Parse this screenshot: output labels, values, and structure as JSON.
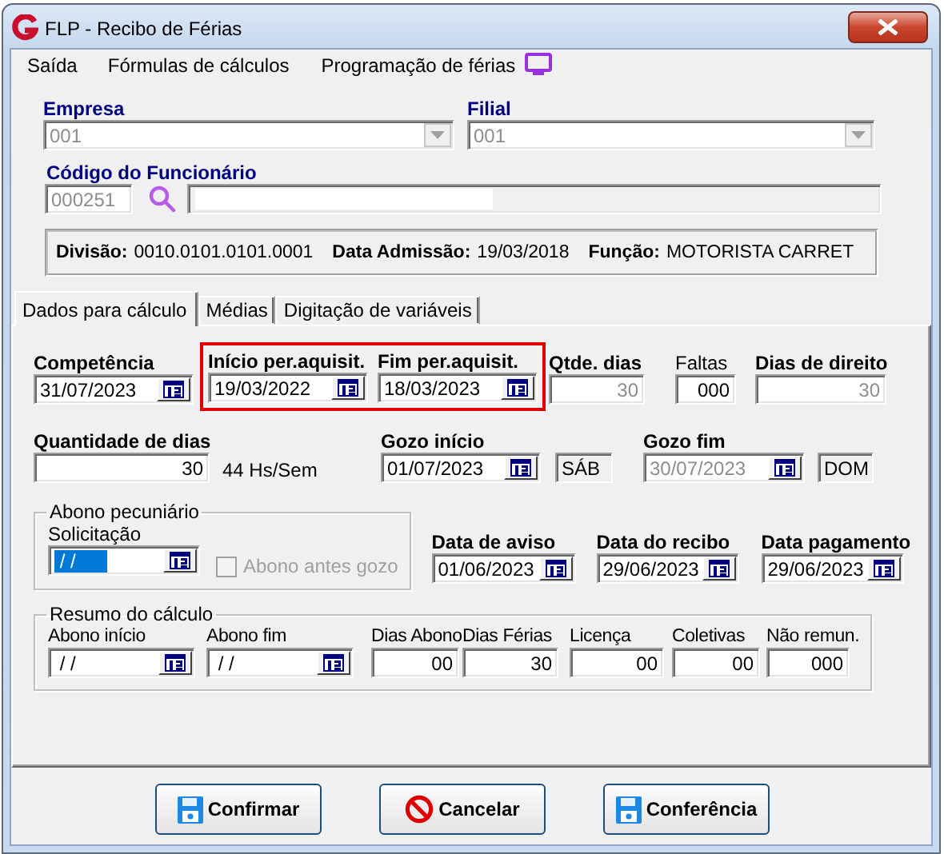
{
  "window": {
    "title": "FLP - Recibo de Férias"
  },
  "menu": [
    {
      "label": "Saída"
    },
    {
      "label": "Fórmulas de cálculos"
    },
    {
      "label": "Programação de férias"
    }
  ],
  "header": {
    "company": {
      "label": "Empresa",
      "value": "001",
      "disabled": true
    },
    "branch": {
      "label": "Filial",
      "value": "001",
      "disabled": true
    },
    "employee": {
      "label": "Código do Funcionário",
      "code": "000251"
    },
    "info": [
      {
        "label": "Divisão:",
        "value": "0010.0101.0101.0001"
      },
      {
        "label": "Data Admissão:",
        "value": "19/03/2018"
      },
      {
        "label": "Função:",
        "value": "MOTORISTA CARRET"
      }
    ]
  },
  "tabs": [
    {
      "label": "Dados para cálculo",
      "selected": true
    },
    {
      "label": "Médias",
      "selected": false
    },
    {
      "label": "Digitação de variáveis",
      "selected": false
    }
  ],
  "calc_rows": [
    [
      {
        "kind": "date",
        "label": "Competência",
        "bold_label": true,
        "value": "31/07/2023",
        "disabled": false
      },
      {
        "kind": "highlight",
        "fields": [
          {
            "kind": "date",
            "label": "Início per.aquisit.",
            "bold_label": true,
            "value": "19/03/2022",
            "disabled": false
          },
          {
            "kind": "date",
            "label": "Fim per.aquisit.",
            "bold_label": true,
            "value": "18/03/2023",
            "disabled": false
          }
        ]
      },
      {
        "kind": "number",
        "label": "Qtde. dias",
        "bold_label": true,
        "value": "30",
        "disabled": true
      },
      {
        "kind": "number",
        "label": "Faltas",
        "bold_label": false,
        "value": "000",
        "disabled": false
      },
      {
        "kind": "number",
        "label": "Dias de direito",
        "bold_label": true,
        "value": "30",
        "disabled": true
      }
    ],
    [
      {
        "kind": "number",
        "label": "Quantidade de dias",
        "bold_label": true,
        "value": "30",
        "disabled": false
      },
      {
        "kind": "note",
        "value": "44 Hs/Sem"
      },
      {
        "kind": "date",
        "label": "Gozo início",
        "bold_label": true,
        "value": "01/07/2023",
        "disabled": false
      },
      {
        "kind": "day",
        "value": "SÁB"
      },
      {
        "kind": "date",
        "label": "Gozo fim",
        "bold_label": true,
        "value": "30/07/2023",
        "disabled": true
      },
      {
        "kind": "day",
        "value": "DOM"
      }
    ],
    [
      {
        "kind": "group",
        "title": "Abono pecuniário",
        "items": [
          {
            "kind": "date",
            "label": "Solicitação",
            "bold_label": false,
            "value": " / /",
            "disabled": false,
            "highlighted": true
          },
          {
            "kind": "checkbox",
            "label": "Abono antes gozo",
            "checked": false,
            "disabled": true
          }
        ]
      },
      {
        "kind": "date",
        "label": "Data de aviso",
        "bold_label": true,
        "value": "01/06/2023",
        "disabled": false
      },
      {
        "kind": "date",
        "label": "Data do recibo",
        "bold_label": true,
        "value": "29/06/2023",
        "disabled": false
      },
      {
        "kind": "date",
        "label": "Data pagamento",
        "bold_label": true,
        "value": "29/06/2023",
        "disabled": false
      }
    ],
    [
      {
        "kind": "group",
        "title": "Resumo do cálculo",
        "items": [
          {
            "kind": "date",
            "label": "Abono início",
            "bold_label": false,
            "value": " / /",
            "disabled": false
          },
          {
            "kind": "date",
            "label": "Abono fim",
            "bold_label": false,
            "value": " / /",
            "disabled": false
          },
          {
            "kind": "number",
            "label": "Dias Abono",
            "bold_label": false,
            "value": "00",
            "disabled": false
          },
          {
            "kind": "number",
            "label": "Dias Férias",
            "bold_label": false,
            "value": "30",
            "disabled": false
          },
          {
            "kind": "number",
            "label": "Licença",
            "bold_label": false,
            "value": "00",
            "disabled": false
          },
          {
            "kind": "number",
            "label": "Coletivas",
            "bold_label": false,
            "value": "00",
            "disabled": false
          },
          {
            "kind": "number",
            "label": "Não remun.",
            "bold_label": false,
            "value": "000",
            "disabled": false
          }
        ]
      }
    ]
  ],
  "buttons": [
    {
      "label": "Confirmar",
      "kind": "save"
    },
    {
      "label": "Cancelar",
      "kind": "cancel"
    },
    {
      "label": "Conferência",
      "kind": "save"
    }
  ]
}
